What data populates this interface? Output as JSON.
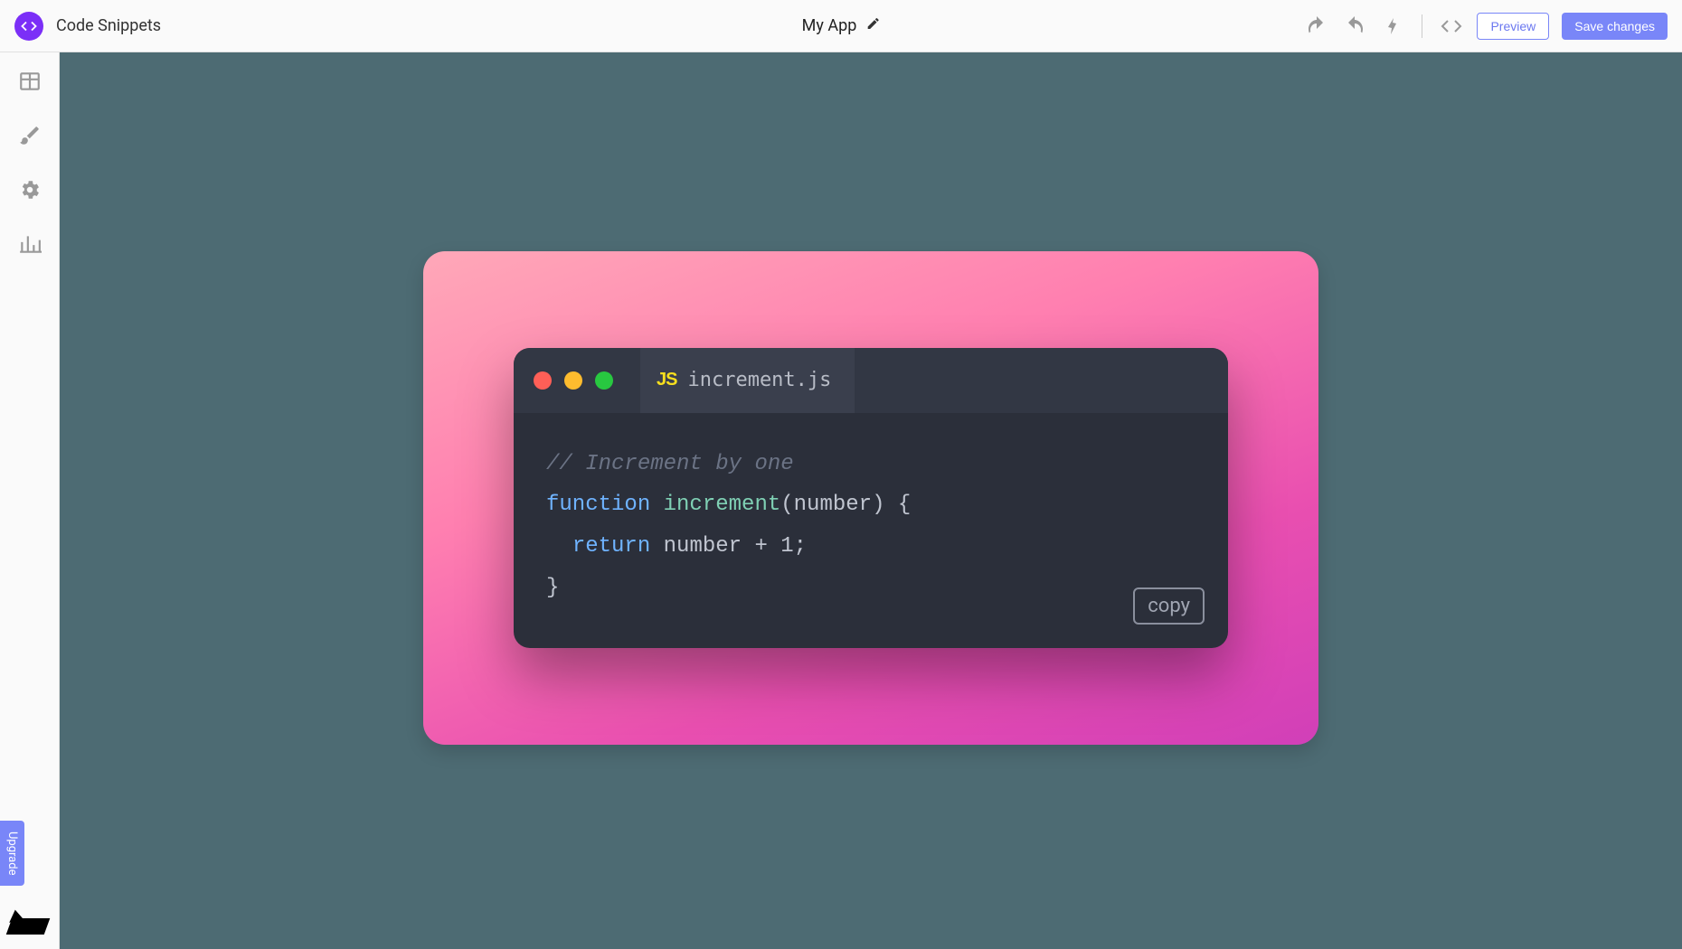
{
  "header": {
    "page_title": "Code Snippets",
    "app_name": "My App",
    "preview_label": "Preview",
    "save_label": "Save changes"
  },
  "sidebar": {
    "upgrade_label": "Upgrade"
  },
  "snippet": {
    "filename": "increment.js",
    "js_badge": "JS",
    "copy_label": "copy",
    "code": {
      "comment": "// Increment by one",
      "kw_function": "function",
      "func_name": "increment",
      "param_open": "(number)",
      "brace_open": " {",
      "indent": "  ",
      "kw_return": "return",
      "expr": " number + ",
      "number_literal": "1",
      "semi": ";",
      "brace_close": "}"
    }
  }
}
